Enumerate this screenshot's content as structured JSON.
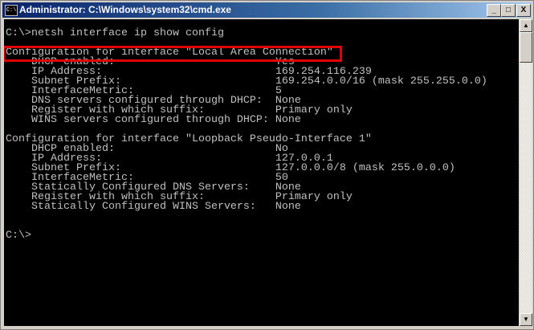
{
  "window": {
    "title": "Administrator: C:\\Windows\\system32\\cmd.exe",
    "icon_label": "C:\\",
    "buttons": {
      "minimize": "_",
      "maximize": "□",
      "close": "X"
    }
  },
  "console": {
    "lines": [
      "C:\\>netsh interface ip show config",
      "",
      "Configuration for interface \"Local Area Connection\"",
      "    DHCP enabled:                         Yes",
      "    IP Address:                           169.254.116.239",
      "    Subnet Prefix:                        169.254.0.0/16 (mask 255.255.0.0)",
      "    InterfaceMetric:                      5",
      "    DNS servers configured through DHCP:  None",
      "    Register with which suffix:           Primary only",
      "    WINS servers configured through DHCP: None",
      "",
      "Configuration for interface \"Loopback Pseudo-Interface 1\"",
      "    DHCP enabled:                         No",
      "    IP Address:                           127.0.0.1",
      "    Subnet Prefix:                        127.0.0.0/8 (mask 255.0.0.0)",
      "    InterfaceMetric:                      50",
      "    Statically Configured DNS Servers:    None",
      "    Register with which suffix:           Primary only",
      "    Statically Configured WINS Servers:   None",
      "",
      "",
      "C:\\>"
    ],
    "highlight_color": "#e00000"
  },
  "scrollbar": {
    "up": "▲",
    "down": "▼"
  }
}
